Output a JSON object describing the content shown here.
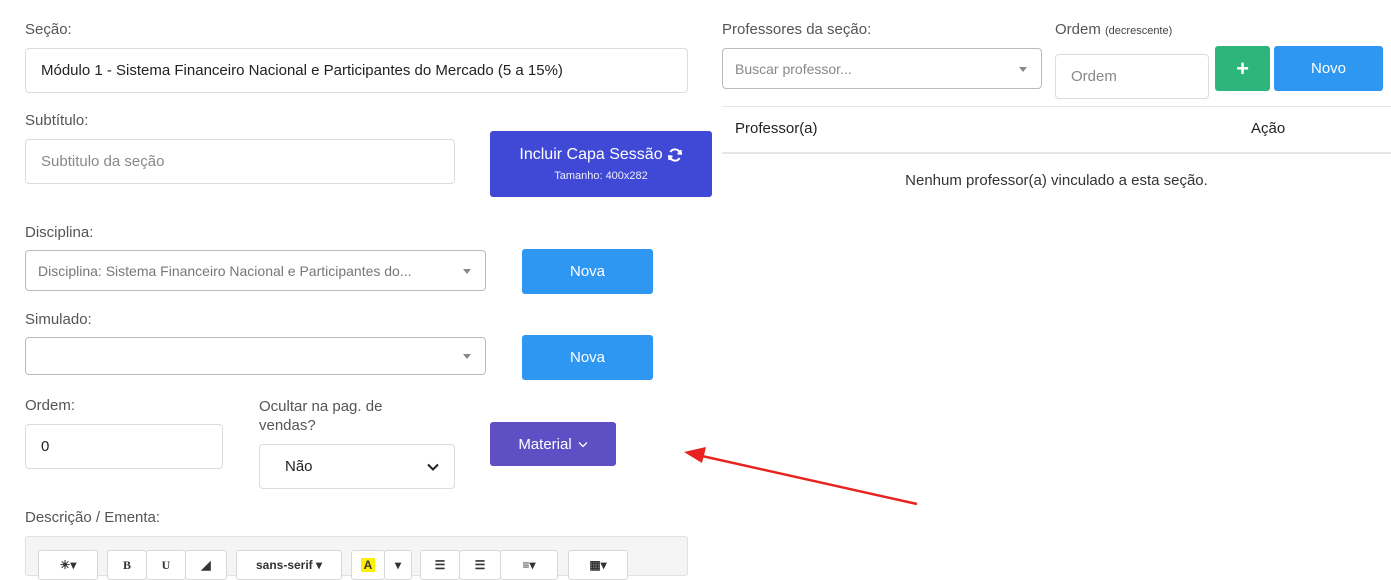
{
  "section": {
    "label": "Seção:",
    "value": "Módulo 1 - Sistema Financeiro Nacional e Participantes do Mercado (5 a 15%)"
  },
  "subtitle": {
    "label": "Subtítulo:",
    "placeholder": "Subtitulo da seção"
  },
  "cover_button": {
    "label": "Incluir Capa Sessão",
    "size_note": "Tamanho: 400x282"
  },
  "discipline": {
    "label": "Disciplina:",
    "value": "Disciplina: Sistema Financeiro Nacional e Participantes do...",
    "new_label": "Nova"
  },
  "simulated": {
    "label": "Simulado:",
    "value": "",
    "new_label": "Nova"
  },
  "order": {
    "label": "Ordem:",
    "value": "0"
  },
  "hide_sales": {
    "label": "Ocultar na pag. de vendas?",
    "value": "Não"
  },
  "material_button": {
    "label": "Material"
  },
  "description": {
    "label": "Descrição / Ementa:"
  },
  "editor_toolbar": {
    "font_label": "sans-serif",
    "bold": "B",
    "underline": "U"
  },
  "professors": {
    "label": "Professores da seção:",
    "search_placeholder": "Buscar professor...",
    "order_label": "Ordem",
    "order_hint": "(decrescente)",
    "order_placeholder": "Ordem",
    "add_symbol": "+",
    "new_label": "Novo",
    "columns": [
      "Professor(a)",
      "Ação"
    ],
    "empty_message": "Nenhum professor(a) vinculado a esta seção."
  },
  "colors": {
    "blue": "#2d97f2",
    "indigo": "#3f49d6",
    "purple": "#5e4fc4",
    "green": "#2db57c",
    "arrow": "#e8231f"
  }
}
